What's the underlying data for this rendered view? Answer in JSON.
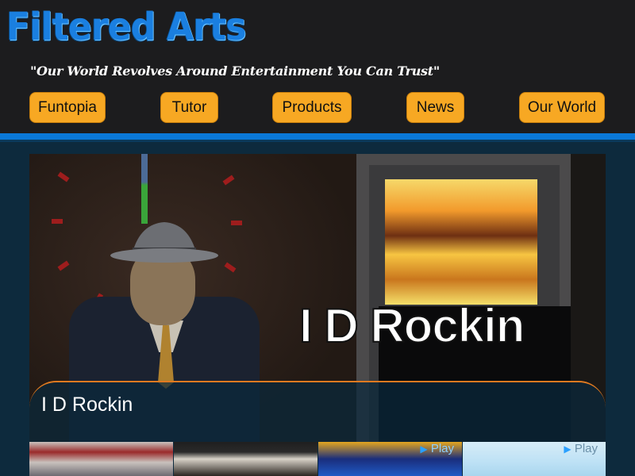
{
  "site": {
    "logo_text": "Filtered Arts",
    "tagline": "\"Our World Revolves Around Entertainment You Can Trust\""
  },
  "nav": {
    "items": [
      {
        "label": "Funtopia"
      },
      {
        "label": "Tutor"
      },
      {
        "label": "Products"
      },
      {
        "label": "News"
      },
      {
        "label": "Our World"
      }
    ]
  },
  "hero": {
    "overlay_text": "I D Rockin",
    "caption": "I D Rockin"
  },
  "thumbnails": [
    {
      "play_label": ""
    },
    {
      "play_label": ""
    },
    {
      "play_label": "Play"
    },
    {
      "play_label": "Play"
    }
  ],
  "colors": {
    "header_bg": "#1c1c1e",
    "accent_blue": "#0a78d8",
    "nav_orange": "#f7a823",
    "page_bg": "#0d2a3d",
    "caption_border": "#e07a20"
  }
}
